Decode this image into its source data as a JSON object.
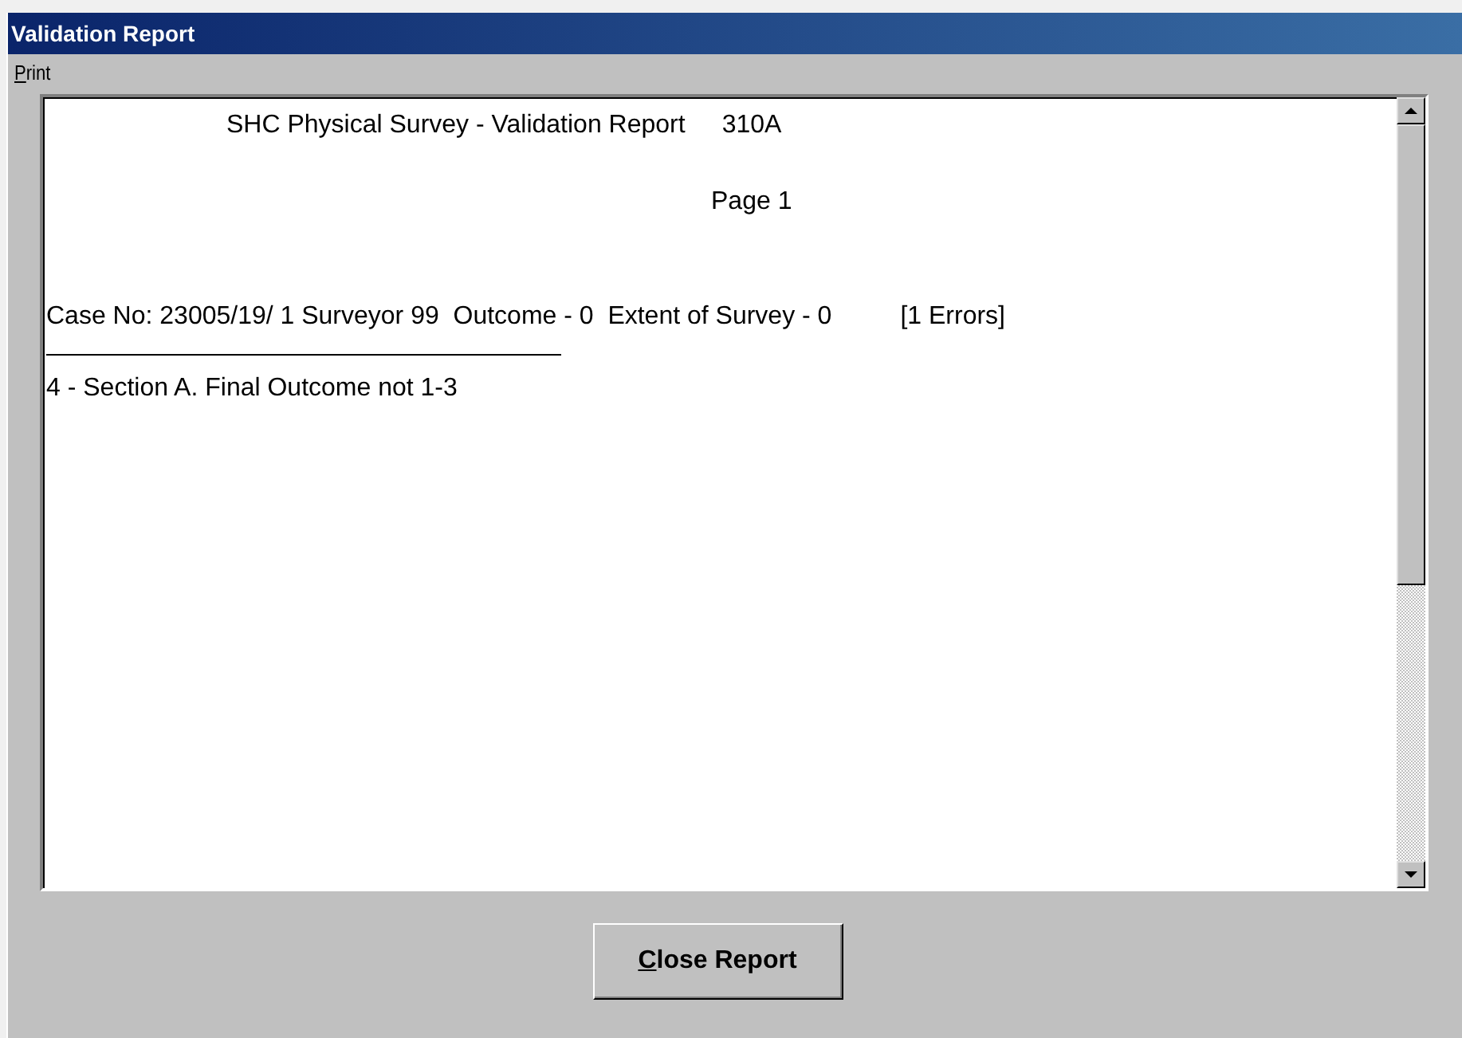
{
  "window": {
    "title": "Validation Report"
  },
  "menu": [
    {
      "label": "Print",
      "underline_first": true
    }
  ],
  "report": {
    "heading": "SHC Physical Survey - Validation Report",
    "form_code": "310A",
    "page": "Page 1",
    "case": {
      "summary": "Case No: 23005/19/ 1 Surveyor 99  Outcome - 0  Extent of Survey - 0",
      "errors": "[1 Errors]"
    },
    "lines": [
      "4 - Section A. Final Outcome not 1-3"
    ]
  },
  "buttons": [
    {
      "label": "Close Report",
      "underline_first": true
    }
  ]
}
